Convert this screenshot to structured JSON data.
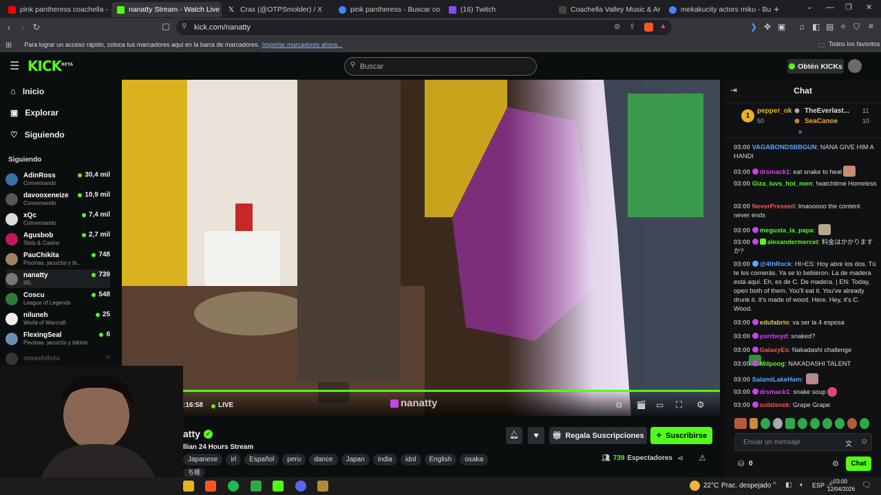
{
  "browser": {
    "tabs": [
      {
        "title": "pink pantheress coachella - YouTube",
        "icon": "youtube-icon",
        "color": "#ff0000"
      },
      {
        "title": "nanatty Stream - Watch Live",
        "icon": "kick-icon",
        "color": "#53fc18"
      },
      {
        "title": "Crax (@OTPSmolder) / X",
        "icon": "x-icon",
        "color": "#ffffff"
      },
      {
        "title": "pink pantheress - Buscar con Google",
        "icon": "google-icon",
        "color": "#4285f4"
      },
      {
        "title": "(16) Twitch",
        "icon": "twitch-icon",
        "color": "#9146ff"
      },
      {
        "title": "Coachella Valley Music & Arts Festival",
        "icon": "coachella-icon",
        "color": "#444"
      },
      {
        "title": "mekakucity actors miku - Buscar con Google",
        "icon": "google-icon",
        "color": "#4285f4"
      }
    ],
    "url": "kick.com/nanatty",
    "bookmarks_text": "Para lograr un acceso rápido, coloca tus marcadores aquí en la barra de marcadores.",
    "bookmarks_link": "Importar marcadores ahora...",
    "all_favorites": "Todos los favoritos"
  },
  "kick": {
    "logo": "KICK",
    "beta": "BETA",
    "search_placeholder": "Buscar",
    "get_kicks": "Obtén KICKs",
    "nav": [
      {
        "label": "Inicio",
        "icon": "home-icon"
      },
      {
        "label": "Explorar",
        "icon": "compass-icon"
      },
      {
        "label": "Siguiendo",
        "icon": "heart-icon"
      }
    ],
    "following_header": "Siguiendo",
    "following": [
      {
        "name": "AdinRoss",
        "game": "Conversando",
        "viewers": "30,4 mil",
        "color": "#3a6ea5"
      },
      {
        "name": "davooxeneize",
        "game": "Conversando",
        "viewers": "10,9 mil",
        "color": "#555"
      },
      {
        "name": "xQc",
        "game": "Conversando",
        "viewers": "7,4 mil",
        "color": "#ddd"
      },
      {
        "name": "Agusbob",
        "game": "Slots & Casino",
        "viewers": "2,7 mil",
        "color": "#c2185b"
      },
      {
        "name": "PauChikita",
        "game": "Piscinas, jacuzzis y bi...",
        "viewers": "748",
        "color": "#a08060"
      },
      {
        "name": "nanatty",
        "game": "IRL",
        "viewers": "739",
        "color": "#777"
      },
      {
        "name": "Coscu",
        "game": "League of Legends",
        "viewers": "548",
        "color": "#2e7d32"
      },
      {
        "name": "niluneh",
        "game": "World of Warcraft",
        "viewers": "25",
        "color": "#eee"
      },
      {
        "name": "FlexingSeal",
        "game": "Piscinas, jacuzzis y bikinis",
        "viewers": "6",
        "color": "#6a8fb0"
      },
      {
        "name": "smashdota",
        "game": "",
        "viewers": "",
        "color": "#666"
      }
    ]
  },
  "player": {
    "time": ":16:58",
    "live_label": "LIVE",
    "watermark": "nanatty"
  },
  "stream": {
    "name": "atty",
    "title": "llian 24 Hours Stream",
    "tags": [
      "Japanese",
      "irl",
      "Español",
      "peru",
      "dance",
      "Japan",
      "india",
      "idol",
      "English",
      "osaka"
    ],
    "extra_tag": "ち姫",
    "follow_bell": "bell-icon",
    "gift_subs": "Regala Suscripciones",
    "subscribe": "Suscribirse",
    "viewers": "739",
    "viewers_label": "Espectadores"
  },
  "chat": {
    "title": "Chat",
    "top_gifters": [
      {
        "name": "pepper_ok",
        "count": "50"
      },
      {
        "name": "TheEverlast...",
        "count": "11"
      },
      {
        "name": "SeaCanoe",
        "count": "10"
      }
    ],
    "messages": [
      {
        "time": "03:00",
        "user": "VAGABONDSBBGUN",
        "color": "#5aa9ff",
        "text": "NANA GIVE HIM A HANDI",
        "badge": false,
        "emote": false
      },
      {
        "time": "03:00",
        "user": "drsmack1",
        "color": "#e040fb",
        "text": "eat snake to heal",
        "badge": true,
        "emote": true
      },
      {
        "time": "03:00",
        "user": "Giza_luvs_hot_men",
        "color": "#53fc18",
        "text": "!watchtime Homeless",
        "badge": false,
        "emote": false
      },
      {
        "time": "03:00",
        "user": "NeverPressed",
        "color": "#ff5252",
        "text": "lmaooooo the content never ends",
        "badge": false,
        "emote": false
      },
      {
        "time": "03:00",
        "user": "megusta_la_papa",
        "color": "#53fc18",
        "text": "",
        "badge": true,
        "emote": true
      },
      {
        "time": "03:00",
        "user": "alexandermercet",
        "color": "#53fc18",
        "text": "料金はかかりますか?",
        "badge": true,
        "emote": false
      },
      {
        "time": "03:00",
        "user": "@4thRock",
        "color": "#5aa9ff",
        "text": "HI>ES: Hoy abre los dos. Tú te los comerás. Ya se lo bebieron. La de madera está aquí. Eh, es de C. De madera. | EN: Today, open both of them. You'll eat it. You've already drunk it. It's made of wood. Here. Hey, it's C. Wood.",
        "badge": true,
        "emote": false
      },
      {
        "time": "03:00",
        "user": "edufabrio",
        "color": "#e6c84a",
        "text": "va ser la 4 esposa",
        "badge": true,
        "emote": false
      },
      {
        "time": "03:00",
        "user": "yurrboyd",
        "color": "#e040fb",
        "text": "snaked?",
        "badge": true,
        "emote": false
      },
      {
        "time": "03:00",
        "user": "GalaxyEs",
        "color": "#ff5252",
        "text": "Nakadashi challenge",
        "badge": true,
        "emote": true
      },
      {
        "time": "03:00",
        "user": "Mdpoog",
        "color": "#53fc18",
        "text": "NAKADASHI TALENT",
        "badge": true,
        "emote": false
      },
      {
        "time": "03:00",
        "user": "SalamiLakeHam",
        "color": "#5aa9ff",
        "text": "",
        "badge": false,
        "emote": true
      },
      {
        "time": "03:00",
        "user": "drsmack1",
        "color": "#e040fb",
        "text": "snake soup",
        "badge": true,
        "emote": true
      },
      {
        "time": "03:00",
        "user": "solidsnek",
        "color": "#ff5252",
        "text": "Grape Grape",
        "badge": true,
        "emote": false
      }
    ],
    "input_placeholder": "Enviar un mensaje",
    "points": "0",
    "send_label": "Chat"
  },
  "taskbar": {
    "weather_temp": "22°C",
    "weather_desc": "Prac. despejado",
    "lang": "ESP",
    "time": "03:00",
    "date": "12/04/2026"
  },
  "colors": {
    "accent": "#53fc18"
  }
}
